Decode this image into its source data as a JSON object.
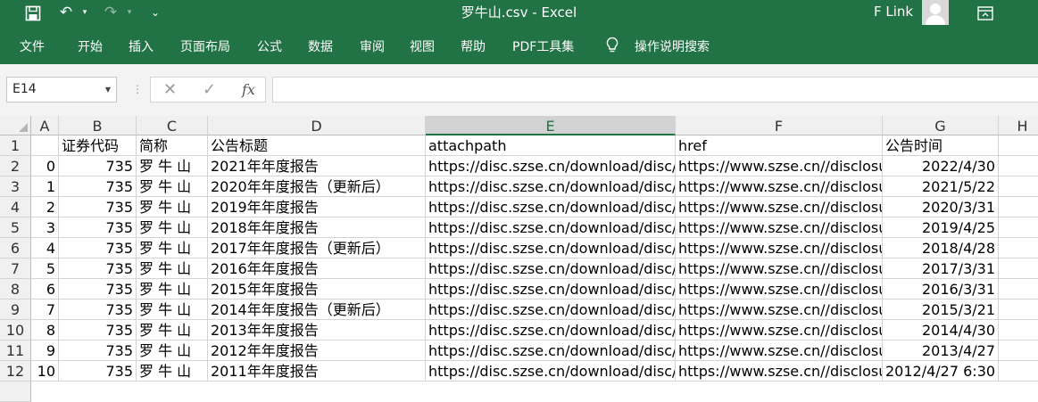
{
  "titlebar": {
    "title": "罗牛山.csv  -  Excel",
    "user": "F Link",
    "icons": [
      "save-icon",
      "undo-icon",
      "redo-icon",
      "customize-qat-icon",
      "ribbon-display-icon"
    ]
  },
  "ribbon": {
    "tabs": [
      "文件",
      "开始",
      "插入",
      "页面布局",
      "公式",
      "数据",
      "审阅",
      "视图",
      "帮助",
      "PDF工具集"
    ],
    "search": "操作说明搜索"
  },
  "formula_bar": {
    "name_box": "E14",
    "cancel": "✕",
    "enter": "✓",
    "fx": "fx",
    "value": ""
  },
  "sheet": {
    "columns": [
      "A",
      "B",
      "C",
      "D",
      "E",
      "F",
      "G",
      "H"
    ],
    "selected_column": "E",
    "selected_cell": "E14",
    "rows": [
      {
        "row": "1",
        "a": "",
        "b": "证券代码",
        "c": "简称",
        "d": "公告标题",
        "e": "attachpath",
        "f": "href",
        "g": "公告时间"
      },
      {
        "row": "2",
        "a": "0",
        "b": "735",
        "c": "罗 牛 山",
        "d": "2021年年度报告",
        "e": "https://disc.szse.cn/download/disc/disc",
        "f": "https://www.szse.cn//disclosure",
        "g": "2022/4/30"
      },
      {
        "row": "3",
        "a": "1",
        "b": "735",
        "c": "罗 牛 山",
        "d": "2020年年度报告（更新后）",
        "e": "https://disc.szse.cn/download/disc/disc",
        "f": "https://www.szse.cn//disclosure",
        "g": "2021/5/22"
      },
      {
        "row": "4",
        "a": "2",
        "b": "735",
        "c": "罗 牛 山",
        "d": "2019年年度报告",
        "e": "https://disc.szse.cn/download/disc/disc",
        "f": "https://www.szse.cn//disclosure",
        "g": "2020/3/31"
      },
      {
        "row": "5",
        "a": "3",
        "b": "735",
        "c": "罗 牛 山",
        "d": "2018年年度报告",
        "e": "https://disc.szse.cn/download/disc/disc",
        "f": "https://www.szse.cn//disclosure",
        "g": "2019/4/25"
      },
      {
        "row": "6",
        "a": "4",
        "b": "735",
        "c": "罗 牛 山",
        "d": "2017年年度报告（更新后）",
        "e": "https://disc.szse.cn/download/disc/disc",
        "f": "https://www.szse.cn//disclosure",
        "g": "2018/4/28"
      },
      {
        "row": "7",
        "a": "5",
        "b": "735",
        "c": "罗 牛 山",
        "d": "2016年年度报告",
        "e": "https://disc.szse.cn/download/disc/disc",
        "f": "https://www.szse.cn//disclosure",
        "g": "2017/3/31"
      },
      {
        "row": "8",
        "a": "6",
        "b": "735",
        "c": "罗 牛 山",
        "d": "2015年年度报告",
        "e": "https://disc.szse.cn/download/disc/disc",
        "f": "https://www.szse.cn//disclosure",
        "g": "2016/3/31"
      },
      {
        "row": "9",
        "a": "7",
        "b": "735",
        "c": "罗 牛 山",
        "d": "2014年年度报告（更新后）",
        "e": "https://disc.szse.cn/download/disc/disc",
        "f": "https://www.szse.cn//disclosure",
        "g": "2015/3/21"
      },
      {
        "row": "10",
        "a": "8",
        "b": "735",
        "c": "罗 牛 山",
        "d": "2013年年度报告",
        "e": "https://disc.szse.cn/download/disc/disc",
        "f": "https://www.szse.cn//disclosure",
        "g": "2014/4/30"
      },
      {
        "row": "11",
        "a": "9",
        "b": "735",
        "c": "罗 牛 山",
        "d": "2012年年度报告",
        "e": "https://disc.szse.cn/download/disc/disc",
        "f": "https://www.szse.cn//disclosure",
        "g": "2013/4/27"
      },
      {
        "row": "12",
        "a": "10",
        "b": "735",
        "c": "罗 牛 山",
        "d": "2011年年度报告",
        "e": "https://disc.szse.cn/download/disc/disc",
        "f": "https://www.szse.cn//disclosure",
        "g": "2012/4/27 6:30"
      }
    ]
  },
  "colors": {
    "accent": "#217346",
    "header_bg": "#f0f0f0",
    "grid_line": "#d4d4d4"
  }
}
